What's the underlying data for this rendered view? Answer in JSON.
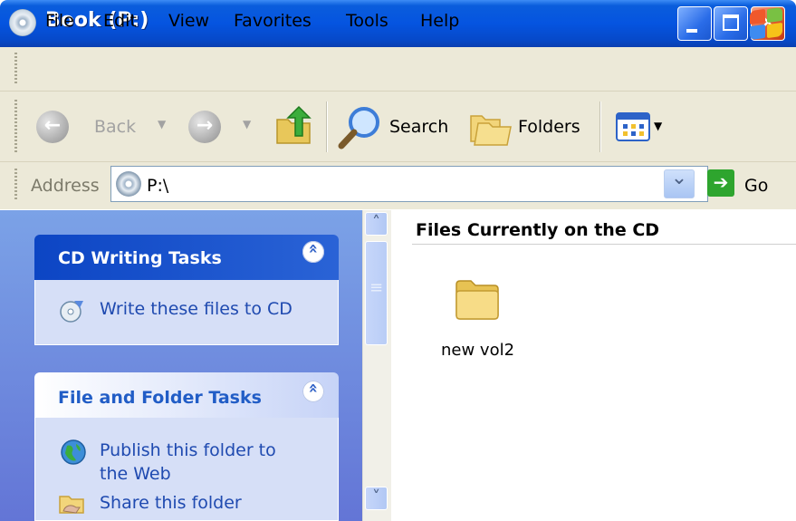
{
  "window": {
    "title": "Book (P:)"
  },
  "menu": [
    "File",
    "Edit",
    "View",
    "Favorites",
    "Tools",
    "Help"
  ],
  "toolbar": {
    "back": "Back",
    "search": "Search",
    "folders": "Folders"
  },
  "address": {
    "label": "Address",
    "value": "P:\\",
    "go": "Go"
  },
  "taskpane": {
    "groups": [
      {
        "title": "CD Writing Tasks",
        "items": [
          "Write these files to CD"
        ]
      },
      {
        "title": "File and Folder Tasks",
        "items": [
          "Publish this folder to the Web",
          "Share this folder"
        ]
      }
    ]
  },
  "content": {
    "header": "Files Currently on the CD",
    "items": [
      {
        "name": "new vol2",
        "icon": "folder-icon"
      }
    ]
  },
  "colors": {
    "titlebar": "#0554e0",
    "taskpane": "#7ba2e7",
    "group_head": "#215dc6",
    "link": "#1f4ab0",
    "folder": "#f2d57a"
  }
}
